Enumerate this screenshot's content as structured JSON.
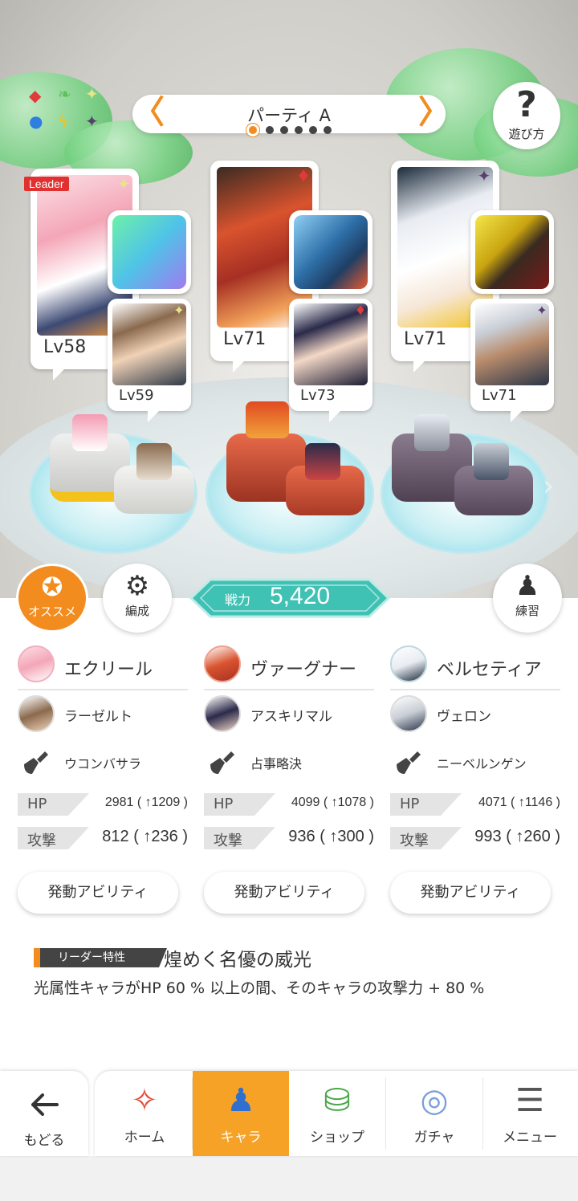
{
  "header": {
    "party_title": "パーティ A",
    "party_pages": 6,
    "party_active_page": 1,
    "help_label": "遊び方"
  },
  "team": {
    "leader_tag": "Leader",
    "members": [
      {
        "lv": "Lv58",
        "attr": "light",
        "sub_lv": "Lv59",
        "sub_attr": "light"
      },
      {
        "lv": "Lv71",
        "attr": "fire",
        "sub_lv": "Lv73",
        "sub_attr": "fire"
      },
      {
        "lv": "Lv71",
        "attr": "dark",
        "sub_lv": "Lv71",
        "sub_attr": "dark"
      }
    ]
  },
  "actions": {
    "recommend_label": "オススメ",
    "formation_label": "編成",
    "power_label": "戦力",
    "power_value": "5,420",
    "practice_label": "練習"
  },
  "columns": [
    {
      "main": "エクリール",
      "sub": "ラーゼルト",
      "weapon": "ウコンバサラ",
      "hp_label": "HP",
      "hp": "2981 ( ↑1209 )",
      "atk_label": "攻撃",
      "atk": "812 ( ↑236 )",
      "ability": "発動アビリティ"
    },
    {
      "main": "ヴァーグナー",
      "sub": "アスキリマル",
      "weapon": "占事略決",
      "hp_label": "HP",
      "hp": "4099 ( ↑1078 )",
      "atk_label": "攻撃",
      "atk": "936 ( ↑300 )",
      "ability": "発動アビリティ"
    },
    {
      "main": "ベルセティア",
      "sub": "ヴェロン",
      "weapon": "ニーベルンゲン",
      "hp_label": "HP",
      "hp": "4071 ( ↑1146 )",
      "atk_label": "攻撃",
      "atk": "993 ( ↑260 )",
      "ability": "発動アビリティ"
    }
  ],
  "leader_skill": {
    "tag": "リーダー特性",
    "title": "煌めく名優の威光",
    "desc": "光属性キャラがHP 60 % 以上の間、そのキャラの攻撃力 + 80 %"
  },
  "nav": {
    "back": "もどる",
    "items": [
      "ホーム",
      "キャラ",
      "ショップ",
      "ガチャ",
      "メニュー"
    ],
    "active": "キャラ"
  },
  "colors": {
    "accent": "#f28c1e",
    "power_teal": "#3fc1b4",
    "fire": "#e03a3a",
    "light": "#e9e48a",
    "dark": "#5a3d73"
  }
}
